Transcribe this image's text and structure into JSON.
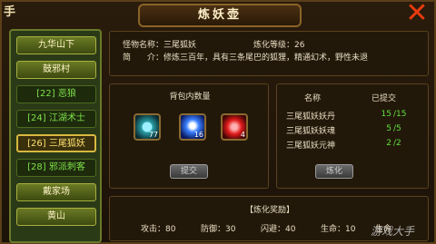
{
  "window": {
    "title": "炼妖壶",
    "corner_text": "手",
    "close_icon": "close-x-icon"
  },
  "sidebar": {
    "items": [
      {
        "label": "九华山下",
        "style": "big"
      },
      {
        "label": "鼓邪村",
        "style": "big"
      },
      {
        "label": "[22] 恶狼",
        "style": "small"
      },
      {
        "label": "[24] 江湖术士",
        "style": "small"
      },
      {
        "label": "[26] 三尾狐妖",
        "style": "active"
      },
      {
        "label": "[28] 邪派刺客",
        "style": "small"
      },
      {
        "label": "戴家场",
        "style": "big"
      },
      {
        "label": "黄山",
        "style": "big"
      }
    ]
  },
  "monster": {
    "name_label": "怪物名称：",
    "name": "三尾狐妖",
    "level_label": "炼化等级：",
    "level": "26",
    "desc_label": "简　　介：",
    "desc": "修炼三百年，具有三条尾巴的狐狸，精通幻术，野性未退"
  },
  "bag": {
    "title": "背包内数量",
    "items": [
      {
        "icon": "green-orb-icon",
        "count": "77"
      },
      {
        "icon": "blue-flame-icon",
        "count": "16"
      },
      {
        "icon": "red-orb-icon",
        "count": "4"
      }
    ],
    "button_label": "提交"
  },
  "requirements": {
    "col_name": "名称",
    "col_submitted": "已提交",
    "rows": [
      {
        "name": "三尾狐妖妖丹",
        "submitted": "15",
        "total": "/15"
      },
      {
        "name": "三尾狐妖妖魂",
        "submitted": "5",
        "total": "/5"
      },
      {
        "name": "三尾狐妖元神",
        "submitted": "2",
        "total": "/2"
      }
    ],
    "button_label": "炼化"
  },
  "reward": {
    "title": "【炼化奖励】",
    "stats": [
      {
        "label": "攻击：",
        "value": "80"
      },
      {
        "label": "防御：",
        "value": "30"
      },
      {
        "label": "闪避：",
        "value": "40"
      },
      {
        "label": "生命：",
        "value": "10"
      },
      {
        "label": "生命",
        "value": ""
      }
    ]
  },
  "watermark": "游戏大手"
}
